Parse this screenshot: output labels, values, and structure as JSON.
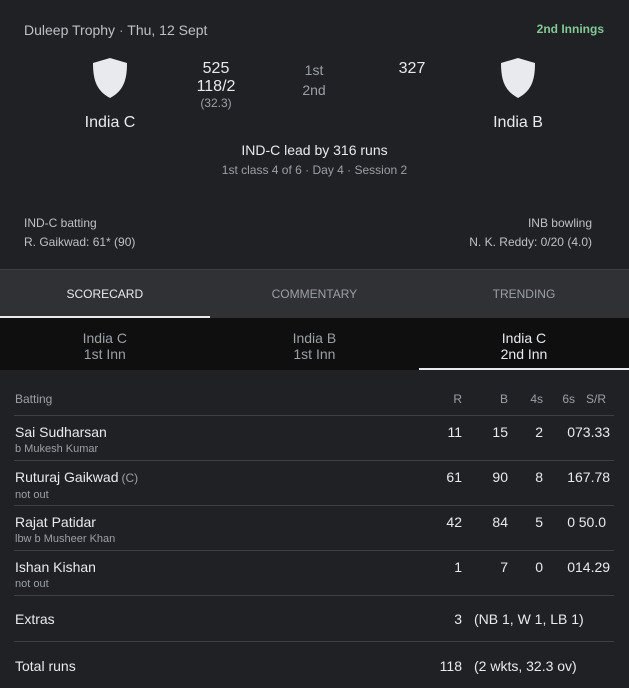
{
  "header": {
    "competition": "Duleep Trophy",
    "separator": "·",
    "date": "Thu, 12 Sept",
    "innings_badge": "2nd Innings",
    "team_left": {
      "name": "India C",
      "score_1st": "525",
      "score_2nd": "118/2",
      "overs_2nd": "(32.3)"
    },
    "team_right": {
      "name": "India B",
      "score_1st": "327"
    },
    "innings_labels": [
      "1st",
      "2nd"
    ],
    "lead_text": "IND-C lead by 316 runs",
    "status_text": "1st class 4 of 6 · Day 4 · Session 2",
    "batting_label": "IND-C batting",
    "batting_value": "R. Gaikwad: 61* (90)",
    "bowling_label": "INB bowling",
    "bowling_value": "N. K. Reddy: 0/20 (4.0)",
    "shield_color": "#e8eaed"
  },
  "tabs": [
    {
      "label": "SCORECARD",
      "active": true
    },
    {
      "label": "COMMENTARY",
      "active": false
    },
    {
      "label": "TRENDING",
      "active": false
    }
  ],
  "innings_tabs": [
    {
      "team": "India C",
      "innings": "1st Inn",
      "active": false
    },
    {
      "team": "India B",
      "innings": "1st Inn",
      "active": false
    },
    {
      "team": "India C",
      "innings": "2nd Inn",
      "active": true
    }
  ],
  "scorecard": {
    "columns": [
      "Batting",
      "R",
      "B",
      "4s",
      "6s",
      "S/R"
    ],
    "batters": [
      {
        "name": "Sai Sudharsan",
        "captain": "",
        "dismissal": "b Mukesh Kumar",
        "r": "11",
        "b": "15",
        "fours": "2",
        "sixes": "0",
        "sr": "73.33"
      },
      {
        "name": "Ruturaj Gaikwad",
        "captain": "(C)",
        "dismissal": "not out",
        "r": "61",
        "b": "90",
        "fours": "8",
        "sixes": "1",
        "sr": "67.78"
      },
      {
        "name": "Rajat Patidar",
        "captain": "",
        "dismissal": "lbw b Musheer Khan",
        "r": "42",
        "b": "84",
        "fours": "5",
        "sixes": "0",
        "sr": "50.0"
      },
      {
        "name": "Ishan Kishan",
        "captain": "",
        "dismissal": "not out",
        "r": "1",
        "b": "7",
        "fours": "0",
        "sixes": "0",
        "sr": "14.29"
      }
    ],
    "extras": {
      "label": "Extras",
      "value": "3",
      "detail": "(NB 1, W 1, LB 1)"
    },
    "total": {
      "label": "Total runs",
      "value": "118",
      "detail": "(2 wkts, 32.3 ov)"
    }
  }
}
